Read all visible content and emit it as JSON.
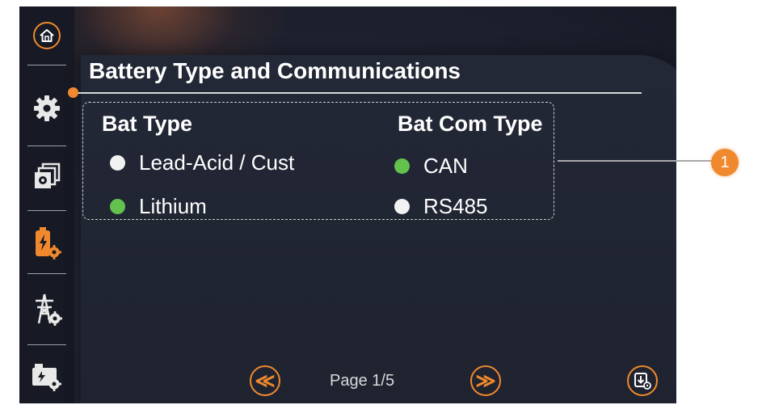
{
  "header": {
    "title": "Battery Type and Communications"
  },
  "bat_type": {
    "heading": "Bat Type",
    "options": [
      {
        "label": "Lead-Acid / Cust",
        "selected": false
      },
      {
        "label": "Lithium",
        "selected": true
      }
    ]
  },
  "bat_com_type": {
    "heading": "Bat Com Type",
    "options": [
      {
        "label": "CAN",
        "selected": true
      },
      {
        "label": "RS485",
        "selected": false
      }
    ]
  },
  "pagination": {
    "label": "Page 1/5",
    "prev_glyph": "≪",
    "next_glyph": "≫"
  },
  "sidebar": {
    "items": [
      "home-icon",
      "gear-icon",
      "stacked-windows-gear-icon",
      "battery-gear-icon",
      "grid-tower-gear-icon",
      "generator-gear-icon"
    ]
  },
  "callout": {
    "number": "1"
  },
  "colors": {
    "accent": "#f0892d",
    "radio_selected": "#63c14e",
    "radio_unselected": "#f2f2f2",
    "background": "#1e2230"
  }
}
